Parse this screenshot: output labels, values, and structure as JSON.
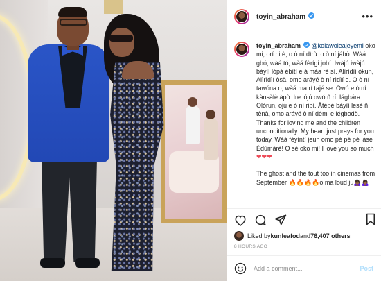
{
  "header": {
    "username": "toyin_abraham",
    "more_label": "•••"
  },
  "caption": {
    "username": "toyin_abraham",
    "mention": "@kolawoleajeyemi",
    "text": " oko mi, orí ni è, o ò ní dìrù. o ò ní jábò. Wàá gbó, wàá tó, wàá fèrígi jobí. Iwàjú iwàjú báyìí lópá èbìtì e á màa rè sí. Alìrìdìí òkun, Alìrìdìí òsà, omo aráyé ò ní rìdìí e. O ò ní tawóna o, wàá ma rí tajé se. Owó e ò ní kànsàlè àpò. Ire lójú owó ñ rí, lágbára Olórun, ojú e ò ní ribì. Àtèpè báyìí lesè ñ tènà, omo aráyé ò ní démi e légbodò. Thanks for loving me and the children unconditionally. My heart just prays for you today. Wàá féyìntì jeun omo pé pé pé láse Èdùmàrè! O sé oko mi! I love you so much ",
    "hearts": "❤❤❤",
    "dot": ".",
    "text2": "The ghost and the tout too in cinemas from September ",
    "fires": "🔥🔥🔥🔥",
    "text3": "o ma loud ju",
    "emoji_end": "🙇🏾‍♀️🙇🏾‍♀️"
  },
  "likes": {
    "prefix": "Liked by ",
    "user": "kunleafod",
    "middle": " and ",
    "count": "76,407 others"
  },
  "timestamp": "8 HOURS AGO",
  "comment": {
    "placeholder": "Add a comment...",
    "post_label": "Post"
  },
  "colors": {
    "verified": "#3897f0",
    "link": "#00376b",
    "post_disabled": "#b2dffc",
    "jacket": "#2a55c7"
  },
  "icons": {
    "like": "heart-icon",
    "comment": "comment-icon",
    "share": "paper-plane-icon",
    "save": "bookmark-icon",
    "emoji": "smiley-icon",
    "verified": "verified-badge-icon",
    "more": "more-options-icon"
  }
}
